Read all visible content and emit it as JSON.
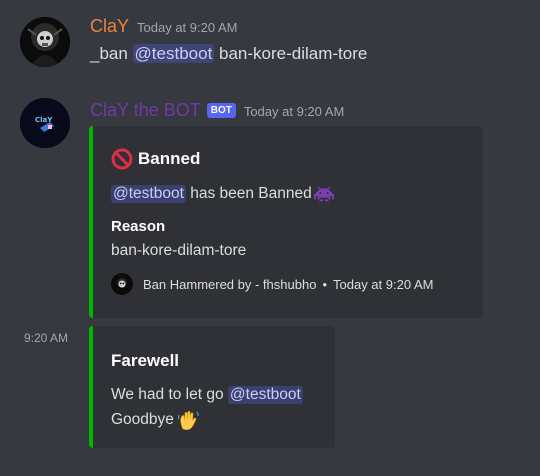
{
  "messages": [
    {
      "username": "ClaY",
      "username_color": "#f0813b",
      "timestamp": "Today at 9:20 AM",
      "content_prefix": "_ban ",
      "mention": "@testboot",
      "content_suffix": " ban-kore-dilam-tore"
    },
    {
      "username": "ClaY the BOT",
      "username_color": "#6f3aa6",
      "bot_tag": "BOT",
      "timestamp": "Today at 9:20 AM",
      "avatar_text": "ClaY",
      "embed": {
        "accent": "#00b700",
        "title_icon": "no-entry-icon",
        "title": "Banned",
        "description_mention": "@testboot",
        "description_text": " has been Banned",
        "description_icon": "space-invader-icon",
        "field_name": "Reason",
        "field_value": "ban-kore-dilam-tore",
        "footer_text": "Ban Hammered by - fhshubho",
        "footer_sep": "•",
        "footer_time": "Today at 9:20 AM"
      }
    },
    {
      "side_time": "9:20 AM",
      "embed": {
        "accent": "#00b700",
        "title": "Farewell",
        "line1_text": "We had to let go ",
        "line1_mention": "@testboot",
        "line2_text": "Goodbye",
        "line2_icon": "waving-hand-icon"
      }
    }
  ]
}
